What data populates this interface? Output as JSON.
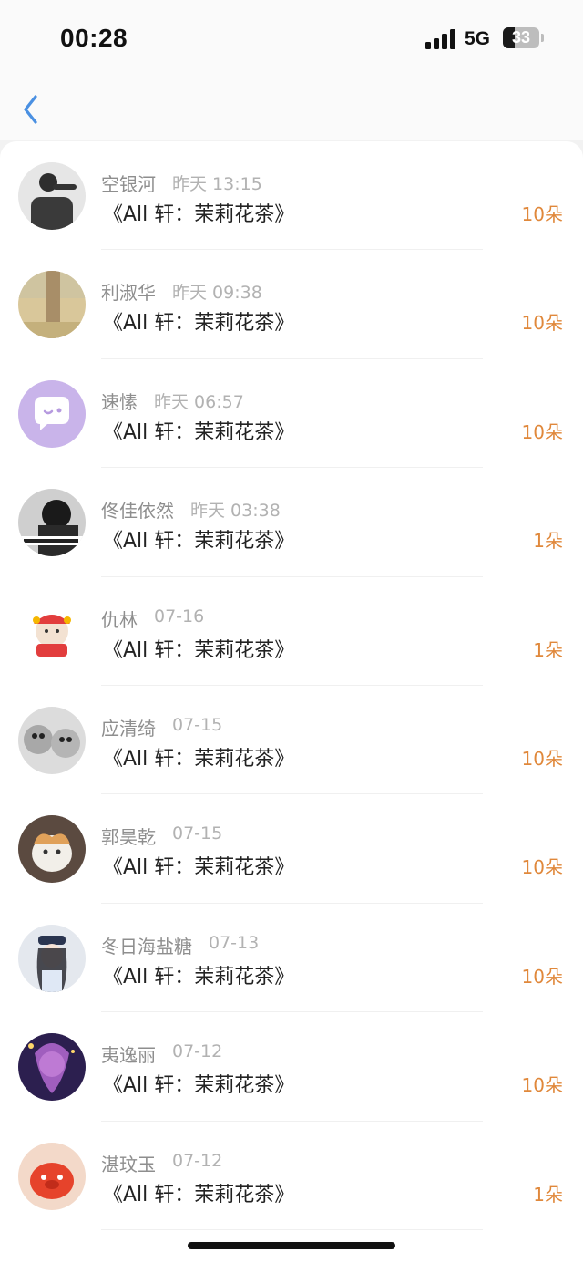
{
  "status": {
    "time": "00:28",
    "network": "5G",
    "battery": "33",
    "battery_level": 0.33
  },
  "nav": {
    "back_icon": "chevron-left-icon",
    "accent": "#4a90e2"
  },
  "colors": {
    "quantity": "#e0883b",
    "name": "#8e8e8e",
    "date": "#b2b2b2"
  },
  "records": [
    {
      "name": "空银河",
      "date": "昨天 13:15",
      "title": "《All 轩：茉莉花茶》",
      "quantity": "10朵",
      "avatar": "person-dark-photo"
    },
    {
      "name": "利淑华",
      "date": "昨天 09:38",
      "title": "《All 轩：茉莉花茶》",
      "quantity": "10朵",
      "avatar": "tree-photo"
    },
    {
      "name": "速愫",
      "date": "昨天 06:57",
      "title": "《All 轩：茉莉花茶》",
      "quantity": "10朵",
      "avatar": "chat-bubble-icon"
    },
    {
      "name": "佟佳依然",
      "date": "昨天 03:38",
      "title": "《All 轩：茉莉花茶》",
      "quantity": "1朵",
      "avatar": "bw-person-photo"
    },
    {
      "name": "仇林",
      "date": "07-16",
      "title": "《All 轩：茉莉花茶》",
      "quantity": "1朵",
      "avatar": "cartoon-lion-photo"
    },
    {
      "name": "应清绮",
      "date": "07-15",
      "title": "《All 轩：茉莉花茶》",
      "quantity": "10朵",
      "avatar": "cats-photo"
    },
    {
      "name": "郭昊乾",
      "date": "07-15",
      "title": "《All 轩：茉莉花茶》",
      "quantity": "10朵",
      "avatar": "cat-photo"
    },
    {
      "name": "冬日海盐糖",
      "date": "07-13",
      "title": "《All 轩：茉莉花茶》",
      "quantity": "10朵",
      "avatar": "anime-girl-photo"
    },
    {
      "name": "夷逸丽",
      "date": "07-12",
      "title": "《All 轩：茉莉花茶》",
      "quantity": "10朵",
      "avatar": "anime-purple-photo"
    },
    {
      "name": "湛玟玉",
      "date": "07-12",
      "title": "《All 轩：茉莉花茶》",
      "quantity": "1朵",
      "avatar": "red-toy-photo"
    }
  ]
}
